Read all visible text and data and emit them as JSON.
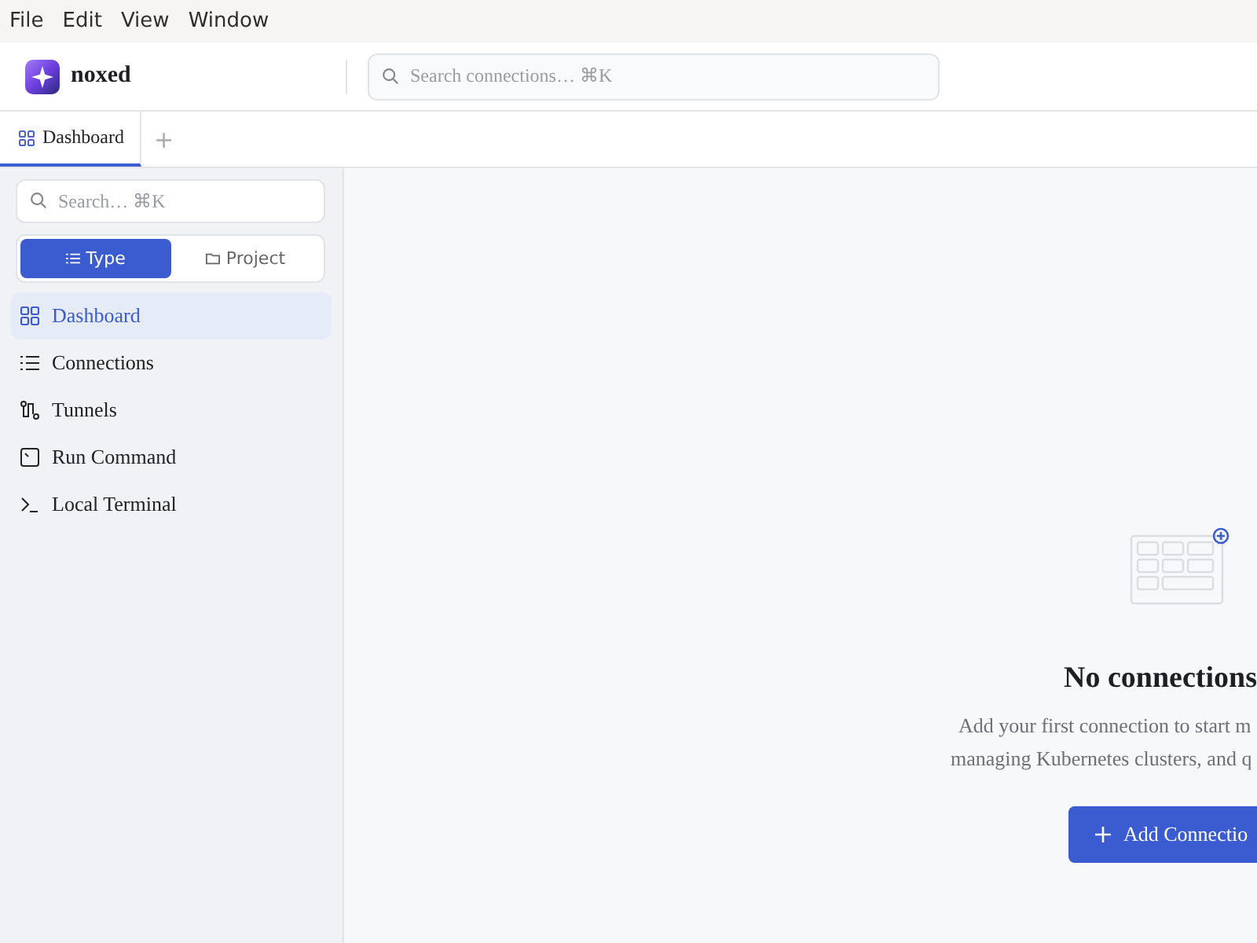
{
  "menu_bar": [
    "File",
    "Edit",
    "View",
    "Window"
  ],
  "header": {
    "app_name": "noxed",
    "search": {
      "placeholder": "Search connections… ⌘K"
    }
  },
  "tabs": [
    {
      "label": "Dashboard",
      "selected": true
    }
  ],
  "add_tab": "+",
  "sidebar": {
    "search": {
      "placeholder": "Search… ⌘K"
    },
    "group_by": [
      {
        "label": "Type",
        "selected": true
      },
      {
        "label": "Project",
        "selected": false
      }
    ],
    "items": [
      {
        "label": "Dashboard",
        "kind": "dashboard",
        "selected": true
      },
      {
        "label": "Connections",
        "kind": "list",
        "selected": false
      },
      {
        "label": "Tunnels",
        "kind": "tunnel",
        "selected": false
      },
      {
        "label": "Run Command",
        "kind": "command",
        "selected": false
      },
      {
        "label": "Local Terminal",
        "kind": "terminal",
        "selected": false
      }
    ]
  },
  "empty_state": {
    "title": "No connections",
    "lines": [
      "Add your first connection to start m",
      "managing Kubernetes clusters, and q"
    ],
    "button": "Add Connectio"
  }
}
